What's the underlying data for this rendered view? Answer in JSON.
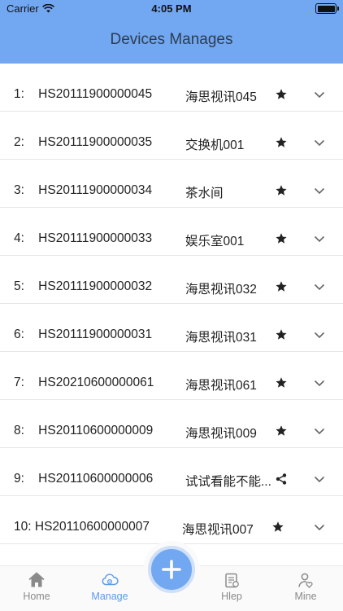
{
  "status_bar": {
    "carrier": "Carrier",
    "time": "4:05 PM"
  },
  "header": {
    "title": "Devices Manages"
  },
  "devices": [
    {
      "index": "1:",
      "id": "HS20111900000045",
      "name": "海思视讯045",
      "mark": "star-icon"
    },
    {
      "index": "2:",
      "id": "HS20111900000035",
      "name": "交换机001",
      "mark": "star-icon"
    },
    {
      "index": "3:",
      "id": "HS20111900000034",
      "name": "茶水间",
      "mark": "star-icon"
    },
    {
      "index": "4:",
      "id": "HS20111900000033",
      "name": "娱乐室001",
      "mark": "star-icon"
    },
    {
      "index": "5:",
      "id": "HS20111900000032",
      "name": "海思视讯032",
      "mark": "star-icon"
    },
    {
      "index": "6:",
      "id": "HS20111900000031",
      "name": "海思视讯031",
      "mark": "star-icon"
    },
    {
      "index": "7:",
      "id": "HS20210600000061",
      "name": "海思视讯061",
      "mark": "star-icon"
    },
    {
      "index": "8:",
      "id": "HS20110600000009",
      "name": "海思视讯009",
      "mark": "star-icon"
    },
    {
      "index": "9:",
      "id": "HS20110600000006",
      "name": "试试看能不能...",
      "mark": "share-icon"
    },
    {
      "index": "10:",
      "id": "HS20110600000007",
      "name": "海思视讯007",
      "mark": "star-icon"
    }
  ],
  "tabbar": {
    "home": "Home",
    "manage": "Manage",
    "help": "Hlep",
    "mine": "Mine",
    "active": "manage",
    "accent_color": "#5b9bea"
  },
  "colors": {
    "header_bg": "#72a7f1",
    "fab_bg": "#72a7f1"
  }
}
